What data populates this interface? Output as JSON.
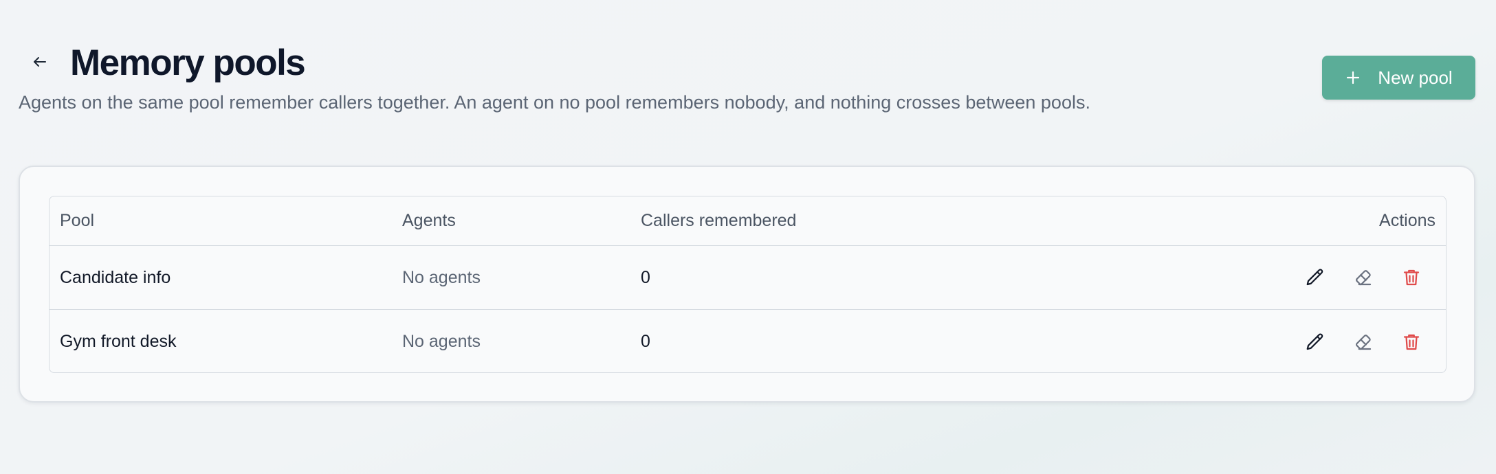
{
  "header": {
    "title": "Memory pools",
    "subtitle": "Agents on the same pool remember callers together. An agent on no pool remembers nobody, and nothing crosses between pools.",
    "back_icon": "arrow-left-icon",
    "new_button": {
      "label": "New pool",
      "icon": "plus-icon"
    }
  },
  "colors": {
    "accent": "#5bad98",
    "danger": "#e04a4a",
    "text_primary": "#0f172a",
    "text_muted": "#5b6574"
  },
  "table": {
    "columns": [
      "Pool",
      "Agents",
      "Callers remembered",
      "Actions"
    ],
    "rows": [
      {
        "pool": "Candidate info",
        "agents": "No agents",
        "callers_remembered": "0"
      },
      {
        "pool": "Gym front desk",
        "agents": "No agents",
        "callers_remembered": "0"
      }
    ],
    "row_actions": [
      "pencil-icon",
      "eraser-icon",
      "trash-icon"
    ]
  }
}
